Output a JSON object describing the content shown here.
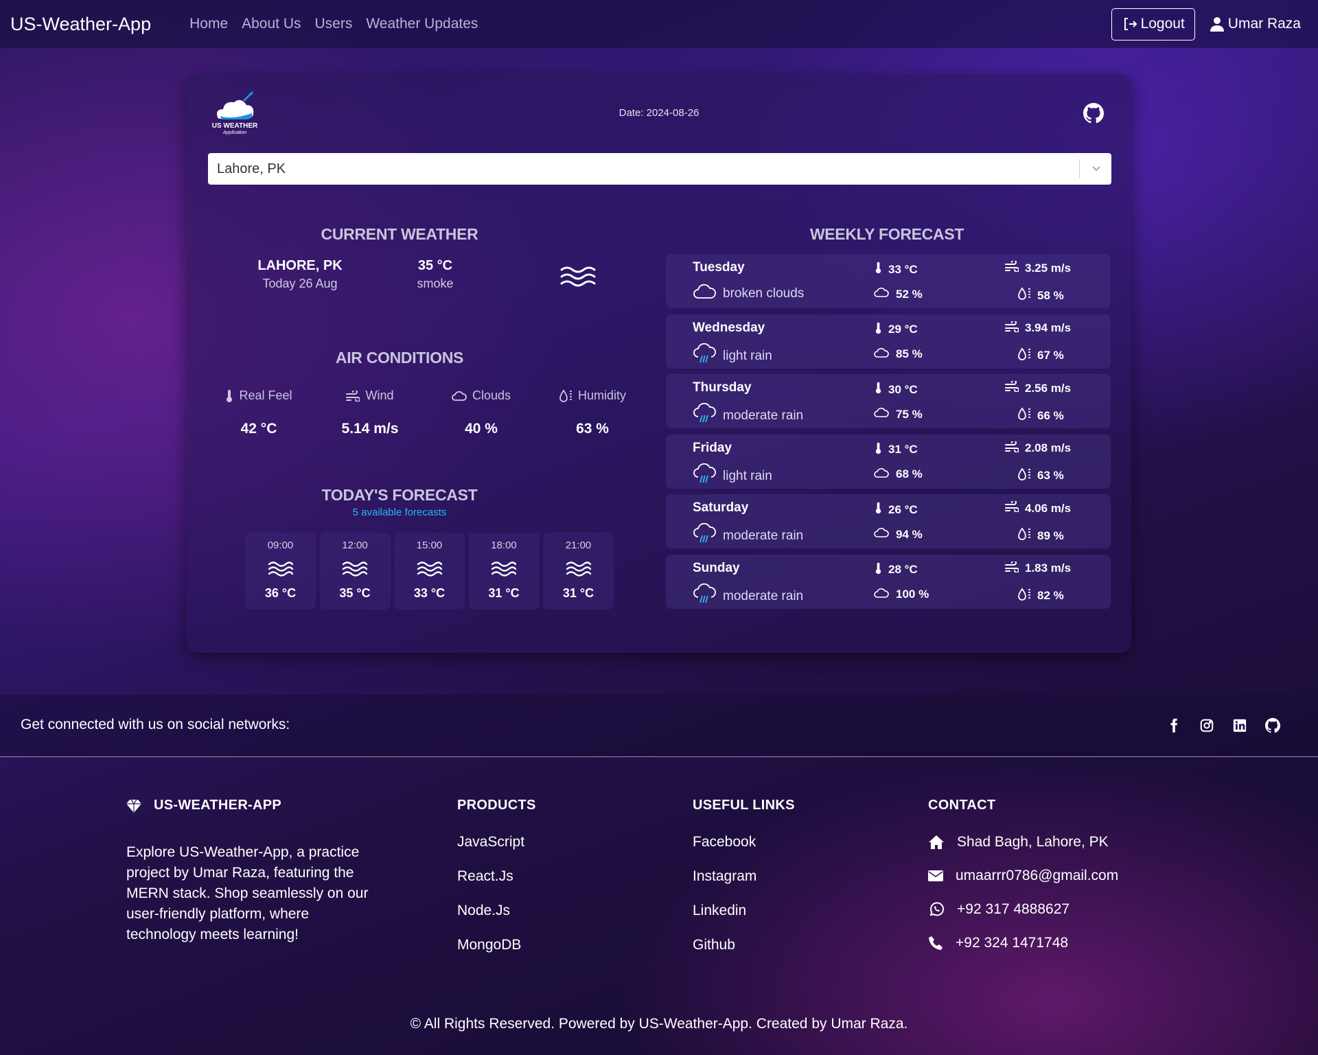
{
  "nav": {
    "brand": "US-Weather-App",
    "links": [
      "Home",
      "About Us",
      "Users",
      "Weather Updates"
    ],
    "logout": "Logout",
    "user": "Umar Raza"
  },
  "card": {
    "logo_text": "US WEATHER",
    "logo_sub": "Application",
    "date": "Date: 2024-08-26",
    "search_value": "Lahore, PK",
    "current_weather": {
      "title": "CURRENT WEATHER",
      "city": "LAHORE, PK",
      "date": "Today 26 Aug",
      "temp": "35 °C",
      "desc": "smoke",
      "icon": "haze-icon"
    },
    "air_conditions": {
      "title": "AIR CONDITIONS",
      "items": [
        {
          "label": "Real Feel",
          "value": "42 °C",
          "icon": "thermometer-icon"
        },
        {
          "label": "Wind",
          "value": "5.14 m/s",
          "icon": "wind-icon"
        },
        {
          "label": "Clouds",
          "value": "40 %",
          "icon": "cloud-icon"
        },
        {
          "label": "Humidity",
          "value": "63 %",
          "icon": "humidity-icon"
        }
      ]
    },
    "todays_forecast": {
      "title": "TODAY'S FORECAST",
      "subtitle": "5 available forecasts",
      "hours": [
        {
          "time": "09:00",
          "temp": "36 °C"
        },
        {
          "time": "12:00",
          "temp": "35 °C"
        },
        {
          "time": "15:00",
          "temp": "33 °C"
        },
        {
          "time": "18:00",
          "temp": "31 °C"
        },
        {
          "time": "21:00",
          "temp": "31 °C"
        }
      ]
    },
    "weekly_forecast": {
      "title": "WEEKLY FORECAST",
      "days": [
        {
          "day": "Tuesday",
          "desc": "broken clouds",
          "temp": "33 °C",
          "wind": "3.25 m/s",
          "clouds": "52 %",
          "humidity": "58 %"
        },
        {
          "day": "Wednesday",
          "desc": "light rain",
          "temp": "29 °C",
          "wind": "3.94 m/s",
          "clouds": "85 %",
          "humidity": "67 %"
        },
        {
          "day": "Thursday",
          "desc": "moderate rain",
          "temp": "30 °C",
          "wind": "2.56 m/s",
          "clouds": "75 %",
          "humidity": "66 %"
        },
        {
          "day": "Friday",
          "desc": "light rain",
          "temp": "31 °C",
          "wind": "2.08 m/s",
          "clouds": "68 %",
          "humidity": "63 %"
        },
        {
          "day": "Saturday",
          "desc": "moderate rain",
          "temp": "26 °C",
          "wind": "4.06 m/s",
          "clouds": "94 %",
          "humidity": "89 %"
        },
        {
          "day": "Sunday",
          "desc": "moderate rain",
          "temp": "28 °C",
          "wind": "1.83 m/s",
          "clouds": "100 %",
          "humidity": "82 %"
        }
      ]
    }
  },
  "footer": {
    "social_text": "Get connected with us on social networks:",
    "about_title": "US-WEATHER-APP",
    "about_desc": "Explore US-Weather-App, a practice project by Umar Raza, featuring the MERN stack. Shop seamlessly on our user-friendly platform, where technology meets learning!",
    "products_title": "PRODUCTS",
    "products": [
      "JavaScript",
      "React.Js",
      "Node.Js",
      "MongoDB"
    ],
    "links_title": "USEFUL LINKS",
    "links": [
      "Facebook",
      "Instagram",
      "Linkedin",
      "Github"
    ],
    "contact_title": "CONTACT",
    "contact": {
      "address": "Shad Bagh, Lahore, PK",
      "email": "umaarrr0786@gmail.com",
      "whatsapp": "+92 317 4888627",
      "phone": "+92 324 1471748"
    },
    "copyright": "© All Rights Reserved. Powered by US-Weather-App. Created by Umar Raza."
  }
}
